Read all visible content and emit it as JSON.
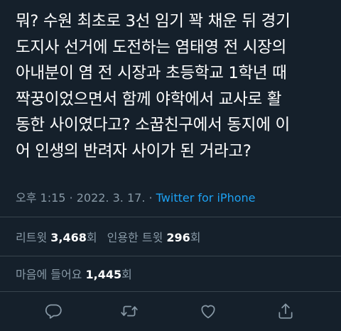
{
  "tweet": {
    "lines": [
      "뭐? 수원 최초로 3선 임기 꽉 채운 뒤 경기",
      "도지사 선거에 도전하는 염태영 전 시장의",
      "아내분이 염 전 시장과 초등학교 1학년 때",
      "짝꿍이었으면서 함께 야학에서 교사로 활",
      "동한 사이였다고? 소꿉친구에서 동지에 이",
      "어 인생의 반려자 사이가 된 거라고?"
    ],
    "timestamp": "오후 1:15 · 2022. 3. 17. · ",
    "source": "Twitter for iPhone"
  },
  "stats": {
    "retweets_label": "리트윗",
    "retweets_count": "3,468",
    "retweets_unit": "회",
    "quotes_label": "인용한 트윗",
    "quotes_count": "296",
    "quotes_unit": "회",
    "likes_label": "마음에 들어요",
    "likes_count": "1,445",
    "likes_unit": "회"
  },
  "actions": {
    "icons": [
      "reply-icon",
      "retweet-icon",
      "like-icon",
      "share-icon"
    ]
  },
  "colors": {
    "background": "#15202b",
    "text": "#ffffff",
    "secondary": "#8899a6",
    "accent": "#1da1f2",
    "divider": "#38444d"
  }
}
